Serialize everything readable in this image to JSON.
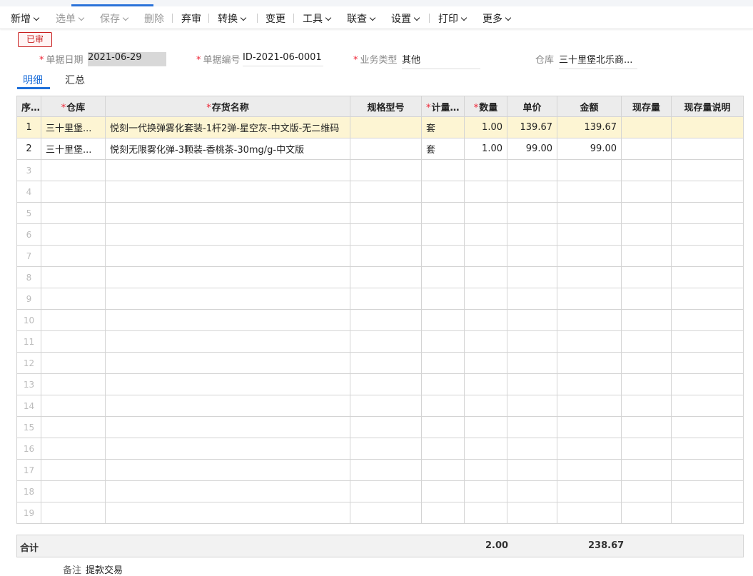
{
  "toolbar": {
    "items": [
      {
        "label": "新增",
        "dropdown": true,
        "disabled": false
      },
      {
        "label": "选单",
        "dropdown": true,
        "disabled": true
      },
      {
        "label": "保存",
        "dropdown": true,
        "disabled": true
      },
      {
        "label": "删除",
        "dropdown": false,
        "disabled": true
      },
      {
        "label": "弃审",
        "dropdown": false,
        "disabled": false
      },
      {
        "label": "转换",
        "dropdown": true,
        "disabled": false
      },
      {
        "label": "变更",
        "dropdown": false,
        "disabled": false
      },
      {
        "label": "工具",
        "dropdown": true,
        "disabled": false
      },
      {
        "label": "联查",
        "dropdown": true,
        "disabled": false
      },
      {
        "label": "设置",
        "dropdown": true,
        "disabled": false
      },
      {
        "label": "打印",
        "dropdown": true,
        "disabled": false
      },
      {
        "label": "更多",
        "dropdown": true,
        "disabled": false
      }
    ]
  },
  "status": {
    "label": "已审",
    "color": "#c81e1e"
  },
  "header": {
    "date": {
      "label": "单据日期",
      "value": "2021-06-29"
    },
    "code": {
      "label": "单据编号",
      "value": "ID-2021-06-0001"
    },
    "biz_type": {
      "label": "业务类型",
      "value": "其他"
    },
    "warehouse": {
      "label": "仓库",
      "value": "三十里堡北乐商..."
    }
  },
  "subtabs": [
    "明细",
    "汇总"
  ],
  "grid": {
    "columns": [
      {
        "label": "序号",
        "required": false
      },
      {
        "label": "仓库",
        "required": true
      },
      {
        "label": "存货名称",
        "required": true
      },
      {
        "label": "规格型号",
        "required": false
      },
      {
        "label": "计量单位",
        "required": true
      },
      {
        "label": "数量",
        "required": true
      },
      {
        "label": "单价",
        "required": false
      },
      {
        "label": "金额",
        "required": false
      },
      {
        "label": "现存量",
        "required": false
      },
      {
        "label": "现存量说明",
        "required": false
      }
    ],
    "rows": [
      {
        "idx": "1",
        "warehouse": "三十里堡...",
        "name": "悦刻一代换弹雾化套装-1杆2弹-星空灰-中文版-无二维码",
        "spec": "",
        "unit": "套",
        "qty": "1.00",
        "price": "139.67",
        "amount": "139.67",
        "stock": "",
        "stock_note": ""
      },
      {
        "idx": "2",
        "warehouse": "三十里堡...",
        "name": "悦刻无限雾化弹-3颗装-香桃茶-30mg/g-中文版",
        "spec": "",
        "unit": "套",
        "qty": "1.00",
        "price": "99.00",
        "amount": "99.00",
        "stock": "",
        "stock_note": ""
      }
    ],
    "empty_row_numbers": [
      "3",
      "4",
      "5",
      "6",
      "7",
      "8",
      "9",
      "10",
      "11",
      "12",
      "13",
      "14",
      "15",
      "16",
      "17",
      "18",
      "19"
    ]
  },
  "totals": {
    "label": "合计",
    "qty": "2.00",
    "amount": "238.67"
  },
  "remark": {
    "label": "备注",
    "value": "提款交易"
  },
  "colors": {
    "accent": "#1e6fd9",
    "highlight_row": "#fdf5d3",
    "required": "#e23"
  }
}
